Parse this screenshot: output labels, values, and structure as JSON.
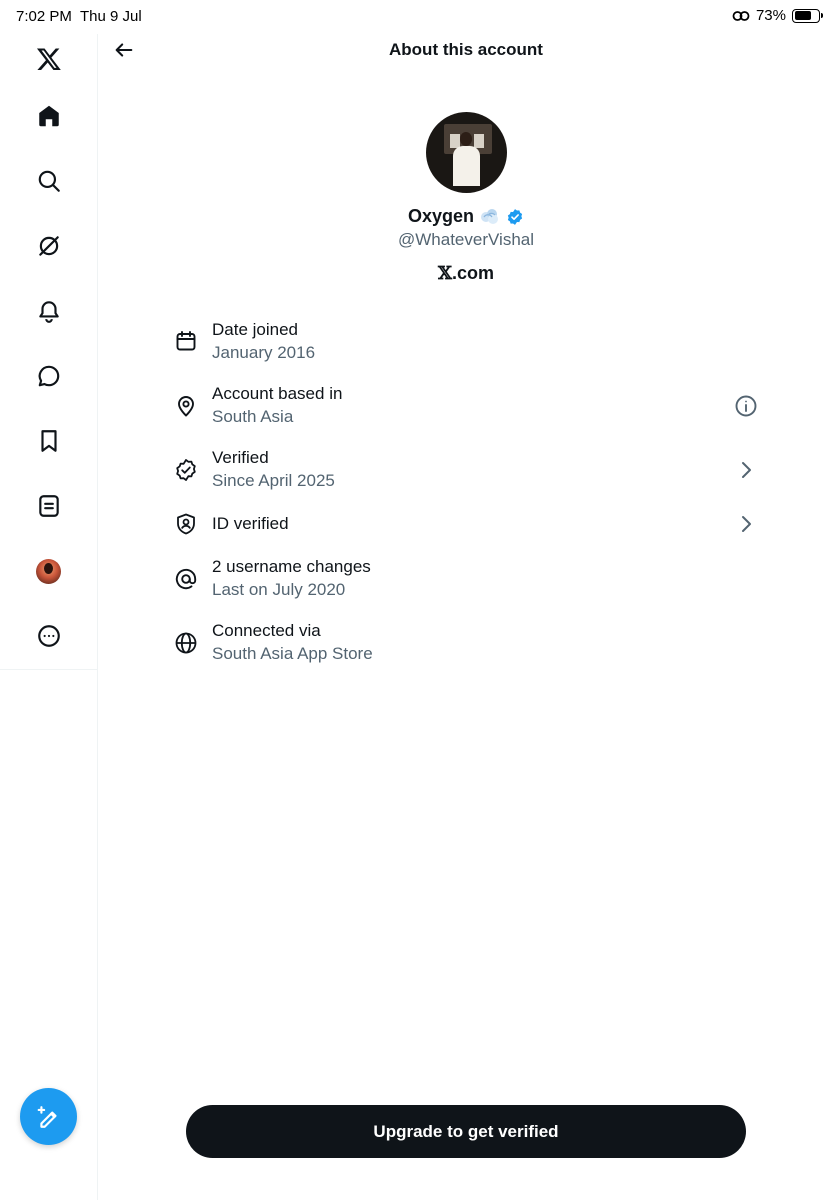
{
  "status_bar": {
    "time": "7:02 PM",
    "date": "Thu 9 Jul",
    "battery": "73%",
    "battery_level": 0.73
  },
  "sidebar": {
    "items": [
      {
        "name": "x-logo-icon"
      },
      {
        "name": "home-icon"
      },
      {
        "name": "search-icon"
      },
      {
        "name": "grok-icon"
      },
      {
        "name": "notifications-icon"
      },
      {
        "name": "messages-icon"
      },
      {
        "name": "bookmarks-icon"
      },
      {
        "name": "lists-icon"
      },
      {
        "name": "profile-avatar-icon"
      },
      {
        "name": "more-icon"
      }
    ],
    "compose_icon": "compose-icon"
  },
  "header": {
    "title": "About this account"
  },
  "profile": {
    "display_name": "Oxygen",
    "handle": "@WhateverVishal",
    "platform_mark": "𝕏",
    "platform_rest": ".com"
  },
  "details": [
    {
      "icon": "calendar-icon",
      "label": "Date joined",
      "sub": "January 2016"
    },
    {
      "icon": "location-icon",
      "label": "Account based in",
      "sub": "South Asia",
      "action": "info-icon"
    },
    {
      "icon": "verified-check-icon",
      "label": "Verified",
      "sub": "Since April 2025",
      "action": "chevron-right-icon"
    },
    {
      "icon": "id-shield-icon",
      "label": "ID verified",
      "sub": "",
      "action": "chevron-right-icon"
    },
    {
      "icon": "at-sign-icon",
      "label": "2 username changes",
      "sub": "Last on July 2020"
    },
    {
      "icon": "globe-icon",
      "label": "Connected via",
      "sub": "South Asia App Store"
    }
  ],
  "cta": {
    "label": "Upgrade to get verified"
  },
  "colors": {
    "accent": "#1d9bf0",
    "text_primary": "#0f1419",
    "text_secondary": "#536471",
    "button_bg": "#0f1419"
  }
}
